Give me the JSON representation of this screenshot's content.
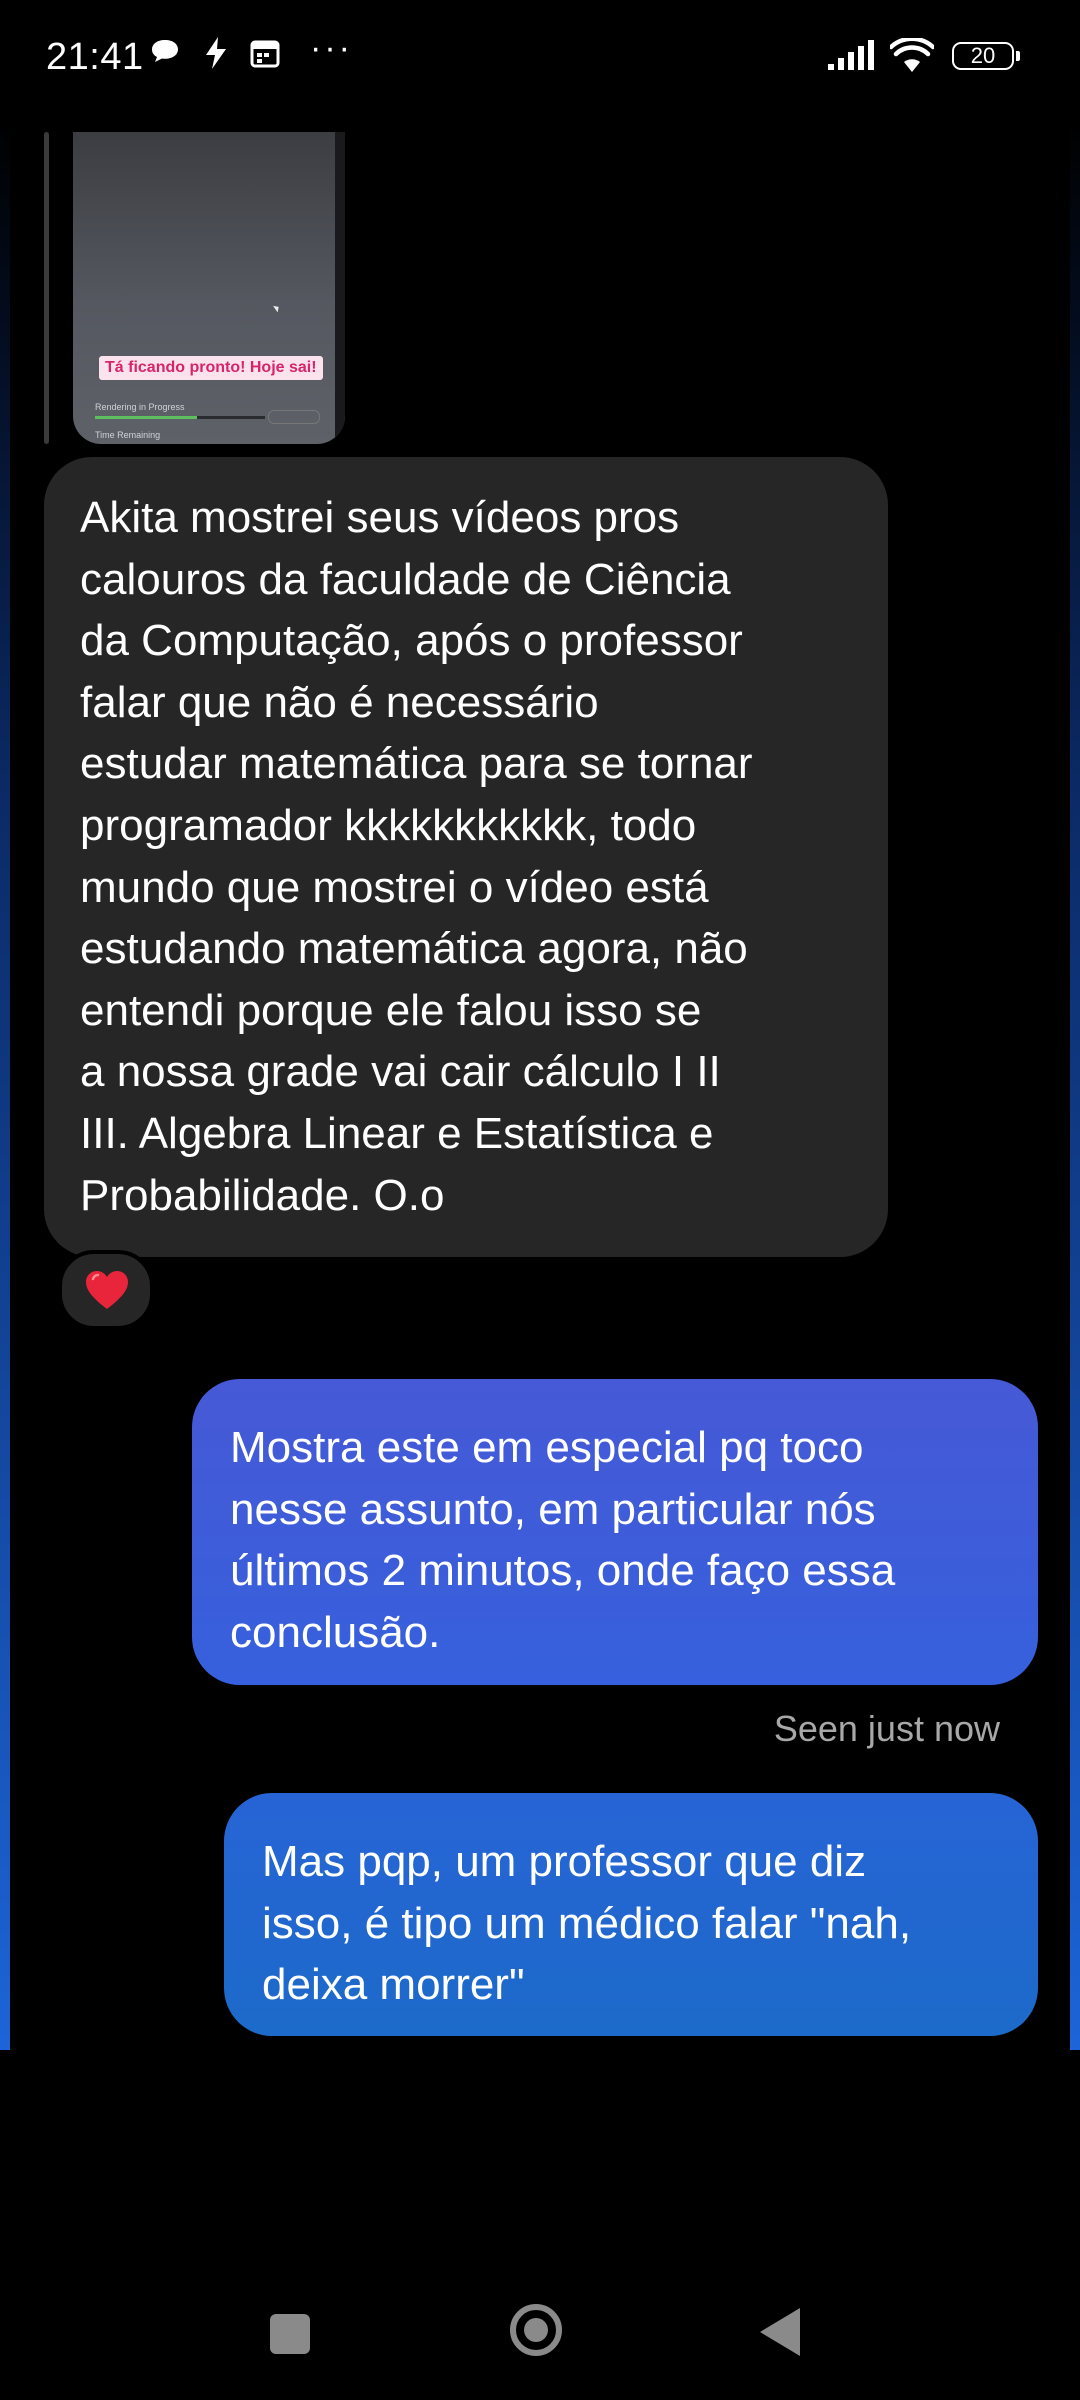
{
  "status_bar": {
    "time": "21:41",
    "battery": "20",
    "overflow": "···"
  },
  "shared_media": {
    "sticker_text": "Tá ficando pronto! Hoje sai!",
    "render_label": "Rendering in Progress",
    "render_remaining": "Time Remaining",
    "render_progress": 0.6
  },
  "messages": {
    "received_1": "Akita mostrei seus vídeos pros\ncalouros da faculdade de Ciência\nda Computação, após o professor\nfalar que não é necessário\nestudar matemática para se tornar\nprogramador kkkkkkkkkkk, todo\nmundo que mostrei o vídeo está\nestudando matemática agora, não\nentendi porque ele falou isso se\na nossa grade vai cair cálculo I II\nIII. Algebra Linear e Estatística e\nProbabilidade. O.o",
    "received_1_reaction": "heart",
    "sent_1": "Mostra este em especial pq toco\nnesse assunto, em particular nós\núltimos 2 minutos, onde faço essa\nconclusão.",
    "seen_status": "Seen just now",
    "sent_2": "Mas pqp, um professor que diz\nisso, é tipo um médico falar \"nah,\ndeixa morrer\""
  },
  "colors": {
    "received_bubble": "#262626",
    "sent_bubble_top": "#4659d6",
    "sent_bubble_bottom": "#1c6ac9",
    "reaction_heart": "#e8253a"
  },
  "nav_bar": {
    "icons": [
      "recents-square-icon",
      "home-circle-icon",
      "back-triangle-icon"
    ]
  }
}
